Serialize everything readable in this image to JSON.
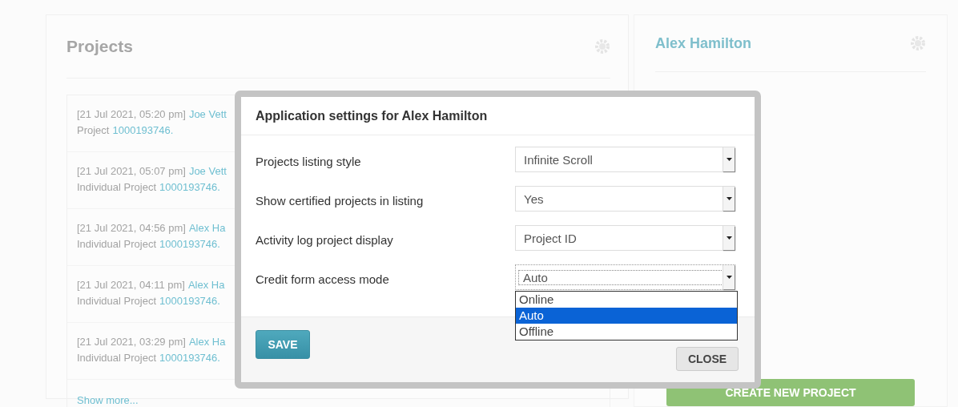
{
  "projects_panel": {
    "title": "Projects",
    "entries": [
      {
        "timestamp": "[21 Jul 2021, 05:20 pm]",
        "user": "Joe Vett",
        "prefix": "Project",
        "project_id": "1000193746."
      },
      {
        "timestamp": "[21 Jul 2021, 05:07 pm]",
        "user": "Joe Vett",
        "prefix": "Individual Project",
        "project_id": "1000193746."
      },
      {
        "timestamp": "[21 Jul 2021, 04:56 pm]",
        "user": "Alex Ha",
        "prefix": "Individual Project",
        "project_id": "1000193746."
      },
      {
        "timestamp": "[21 Jul 2021, 04:11 pm]",
        "user": "Alex Ha",
        "prefix": "Individual Project",
        "project_id": "1000193746."
      },
      {
        "timestamp": "[21 Jul 2021, 03:29 pm]",
        "user": "Alex Ha",
        "prefix": "Individual Project",
        "project_id": "1000193746."
      }
    ],
    "show_more": "Show more..."
  },
  "profile_panel": {
    "name": "Alex Hamilton",
    "create_button": "CREATE NEW PROJECT"
  },
  "dialog": {
    "title": "Application settings for Alex Hamilton",
    "settings": [
      {
        "label": "Projects listing style",
        "value": "Infinite Scroll",
        "focused": false
      },
      {
        "label": "Show certified projects in listing",
        "value": "Yes",
        "focused": false
      },
      {
        "label": "Activity log project display",
        "value": "Project ID",
        "focused": false
      },
      {
        "label": "Credit form access mode",
        "value": "Auto",
        "focused": true,
        "options": [
          {
            "label": "Online",
            "selected": false
          },
          {
            "label": "Auto",
            "selected": true
          },
          {
            "label": "Offline",
            "selected": false
          }
        ]
      }
    ],
    "save_button": "SAVE",
    "close_button": "CLOSE"
  }
}
